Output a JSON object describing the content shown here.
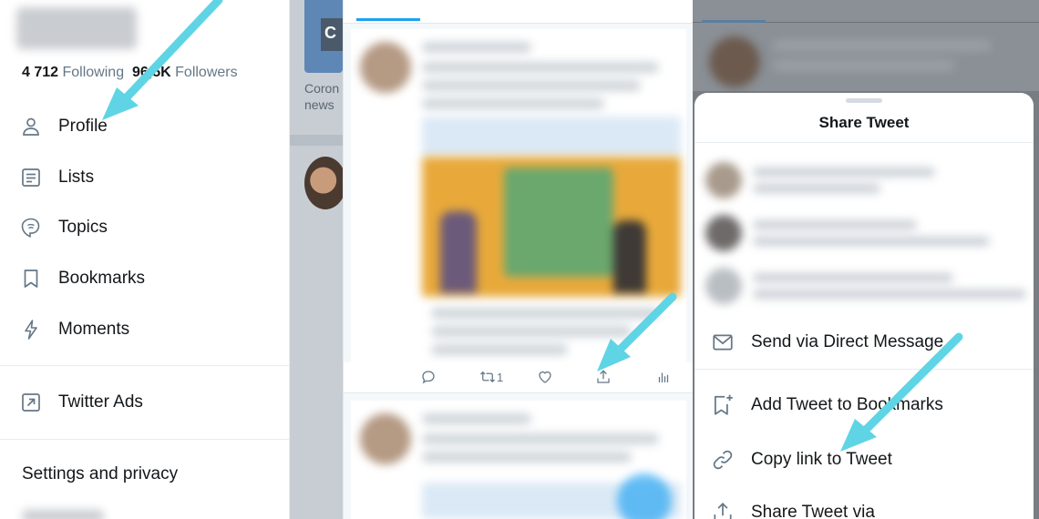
{
  "drawer": {
    "following_count": "4 712",
    "following_label": "Following",
    "followers_count": "96,5K",
    "followers_label": "Followers",
    "items": [
      {
        "label": "Profile",
        "icon": "person-icon"
      },
      {
        "label": "Lists",
        "icon": "list-icon"
      },
      {
        "label": "Topics",
        "icon": "topic-icon"
      },
      {
        "label": "Bookmarks",
        "icon": "bookmark-icon"
      },
      {
        "label": "Moments",
        "icon": "lightning-icon"
      }
    ],
    "ads_label": "Twitter Ads",
    "settings_label": "Settings and privacy"
  },
  "background_feed": {
    "card_letter": "C",
    "card_text_line1": "Coron",
    "card_text_line2": "news"
  },
  "tweet": {
    "retweet_count": "1"
  },
  "share_sheet": {
    "title": "Share Tweet",
    "options": [
      {
        "label": "Send via Direct Message",
        "icon": "mail-icon"
      },
      {
        "label": "Add Tweet to Bookmarks",
        "icon": "bookmark-add-icon"
      },
      {
        "label": "Copy link to Tweet",
        "icon": "link-icon"
      },
      {
        "label": "Share Tweet via",
        "icon": "share-icon"
      }
    ]
  },
  "colors": {
    "accent": "#1da1f2",
    "annotation_arrow": "#5fd4e4"
  }
}
